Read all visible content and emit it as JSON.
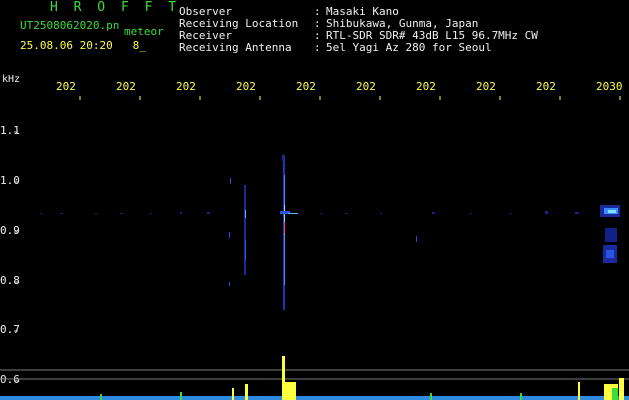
{
  "header": {
    "title": "H R O F F T",
    "filename": "UT2508062020.pn",
    "meteor_label": "meteor",
    "datetime": "25.08.06 20:20",
    "counter": "8_"
  },
  "info": {
    "labels": [
      "Observer",
      "Receiving Location",
      "Receiver",
      "Receiving Antenna"
    ],
    "values": [
      "Masaki Kano",
      "Shibukawa, Gunma, Japan",
      "RTL-SDR SDR# 43dB L15 96.7MHz CW",
      "5el Yagi Az 280 for Seoul"
    ]
  },
  "axis": {
    "unit": "kHz",
    "x_ticks": [
      "202",
      "202",
      "202",
      "202",
      "202",
      "202",
      "202",
      "202",
      "202",
      "2030"
    ],
    "y_ticks": [
      "1.1",
      "1.0",
      "0.9",
      "0.8",
      "0.7",
      "0.6"
    ]
  },
  "colors": {
    "background": "#000000",
    "header_green": "#3cdc3c",
    "tick_yellow": "#ffff40",
    "label_white": "#f0f0f0",
    "guide_line": "#7a7a7a"
  }
}
